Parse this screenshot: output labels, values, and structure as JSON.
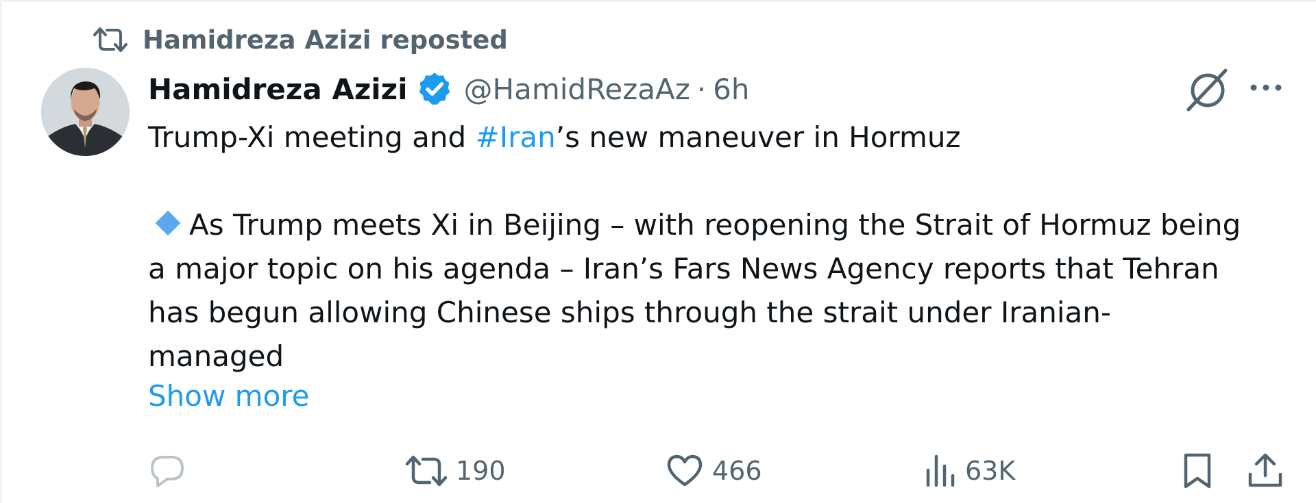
{
  "repost": {
    "icon": "repost-icon",
    "label": "Hamidreza Azizi reposted"
  },
  "author": {
    "avatar_icon": "avatar",
    "name": "Hamidreza Azizi",
    "verified_icon": "verified-badge-icon",
    "handle": "@HamidRezaAz",
    "separator": "·",
    "time": "6h"
  },
  "header_actions": {
    "grok_icon": "grok-icon",
    "more_icon": "more-options-icon"
  },
  "tweet": {
    "line1_before": "Trump-Xi meeting and ",
    "hashtag": "#Iran",
    "line1_after": "’s new maneuver in Hormuz",
    "bullet_icon": "diamond-bullet-icon",
    "line2": "As Trump meets Xi in Beijing – with reopening the Strait of Hormuz being",
    "line3": "a major topic on his agenda – Iran’s Fars News Agency reports that Tehran",
    "line4": "has begun allowing Chinese ships through the strait under Iranian-",
    "line5": "managed",
    "show_more": "Show more"
  },
  "actions": {
    "reply": {
      "icon": "reply-icon",
      "count": ""
    },
    "repost": {
      "icon": "repost-icon",
      "count": "190"
    },
    "like": {
      "icon": "heart-icon",
      "count": "466"
    },
    "views": {
      "icon": "views-chart-icon",
      "count": "63K"
    },
    "bookmark": {
      "icon": "bookmark-icon"
    },
    "share": {
      "icon": "share-icon"
    }
  },
  "colors": {
    "accent": "#1d9bf0",
    "secondary_text": "#536471",
    "primary_text": "#0f1419",
    "bullet": "#5aa9f0"
  }
}
